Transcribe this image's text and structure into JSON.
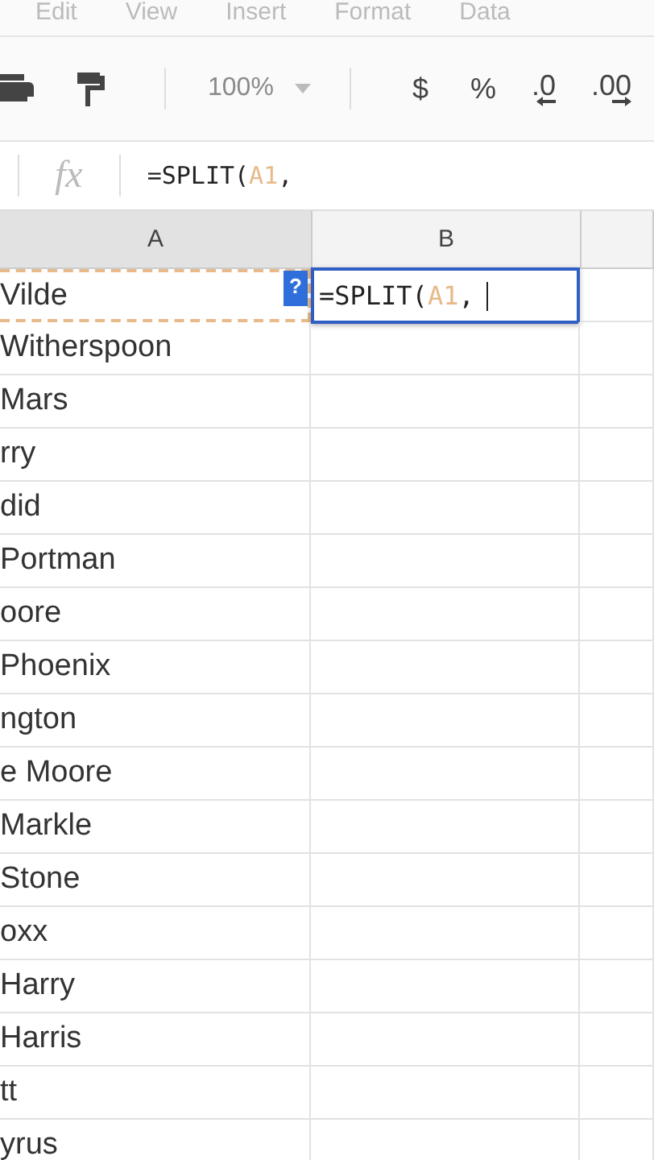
{
  "menu": [
    "Edit",
    "View",
    "Insert",
    "Format",
    "Data"
  ],
  "toolbar": {
    "zoom": "100%",
    "currency": "$",
    "percent": "%",
    "decrease_decimals": ".0",
    "increase_decimals": ".00"
  },
  "formula_bar": {
    "fx": "fx",
    "start": "=SPLIT(",
    "ref": "A1",
    "end": ","
  },
  "columns": [
    "A",
    "B"
  ],
  "editor": {
    "hint": "?",
    "start": "=SPLIT(",
    "ref": "A1",
    "end": ","
  },
  "rows": [
    {
      "a": "Vilde",
      "referenced": true,
      "editing": true
    },
    {
      "a": "Witherspoon",
      "referenced": false,
      "editing": false
    },
    {
      "a": "Mars",
      "referenced": false,
      "editing": false
    },
    {
      "a": "rry",
      "referenced": false,
      "editing": false
    },
    {
      "a": "did",
      "referenced": false,
      "editing": false
    },
    {
      "a": "Portman",
      "referenced": false,
      "editing": false
    },
    {
      "a": "oore",
      "referenced": false,
      "editing": false
    },
    {
      "a": "Phoenix",
      "referenced": false,
      "editing": false
    },
    {
      "a": "ngton",
      "referenced": false,
      "editing": false
    },
    {
      "a": "e Moore",
      "referenced": false,
      "editing": false
    },
    {
      "a": "Markle",
      "referenced": false,
      "editing": false
    },
    {
      "a": "Stone",
      "referenced": false,
      "editing": false
    },
    {
      "a": "oxx",
      "referenced": false,
      "editing": false
    },
    {
      "a": "Harry",
      "referenced": false,
      "editing": false
    },
    {
      "a": "Harris",
      "referenced": false,
      "editing": false
    },
    {
      "a": "tt",
      "referenced": false,
      "editing": false
    },
    {
      "a": "yrus",
      "referenced": false,
      "editing": false
    }
  ]
}
